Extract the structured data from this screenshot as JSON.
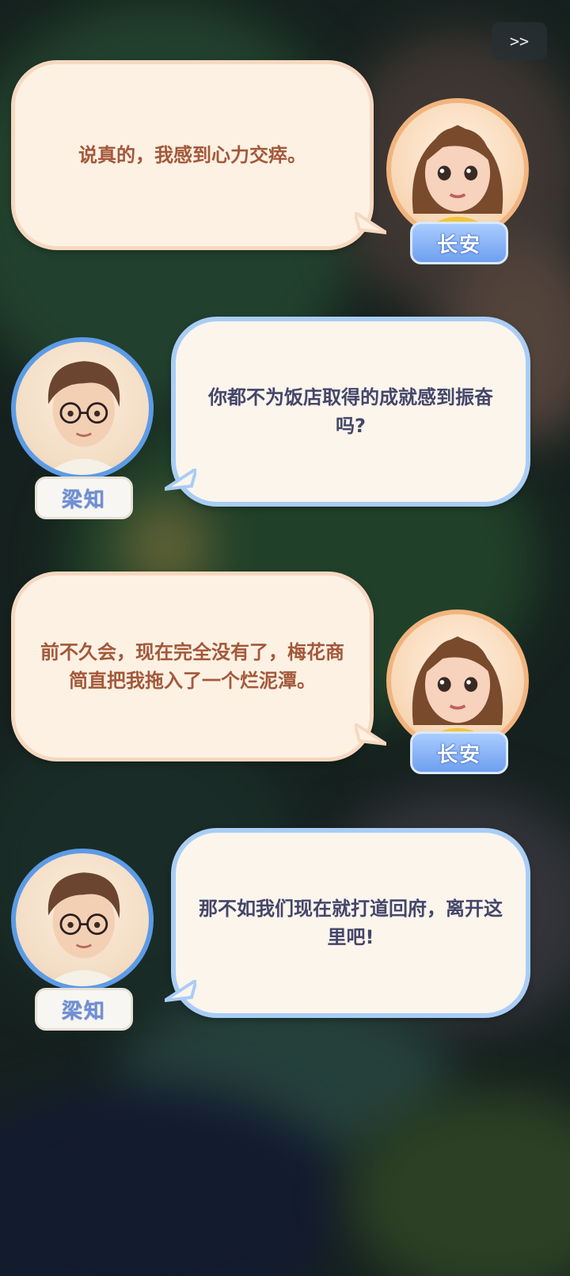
{
  "skip_label": ">>",
  "dialogue": [
    {
      "speaker": "长安",
      "text": "说真的，我感到心力交瘁。"
    },
    {
      "speaker": "梁知",
      "text": "你都不为饭店取得的成就感到振奋吗?"
    },
    {
      "speaker": "长安",
      "text": "前不久会，现在完全没有了，梅花商简直把我拖入了一个烂泥潭。"
    },
    {
      "speaker": "梁知",
      "text": "那不如我们现在就打道回府，离开这里吧!"
    }
  ],
  "colors": {
    "warm_text": "#a3583a",
    "cool_text": "#44466a",
    "warm_border": "#f7d8c0",
    "cool_border": "#a9cdf5"
  },
  "icons": [
    "skip-icon",
    "female-character-portrait",
    "male-character-portrait"
  ]
}
